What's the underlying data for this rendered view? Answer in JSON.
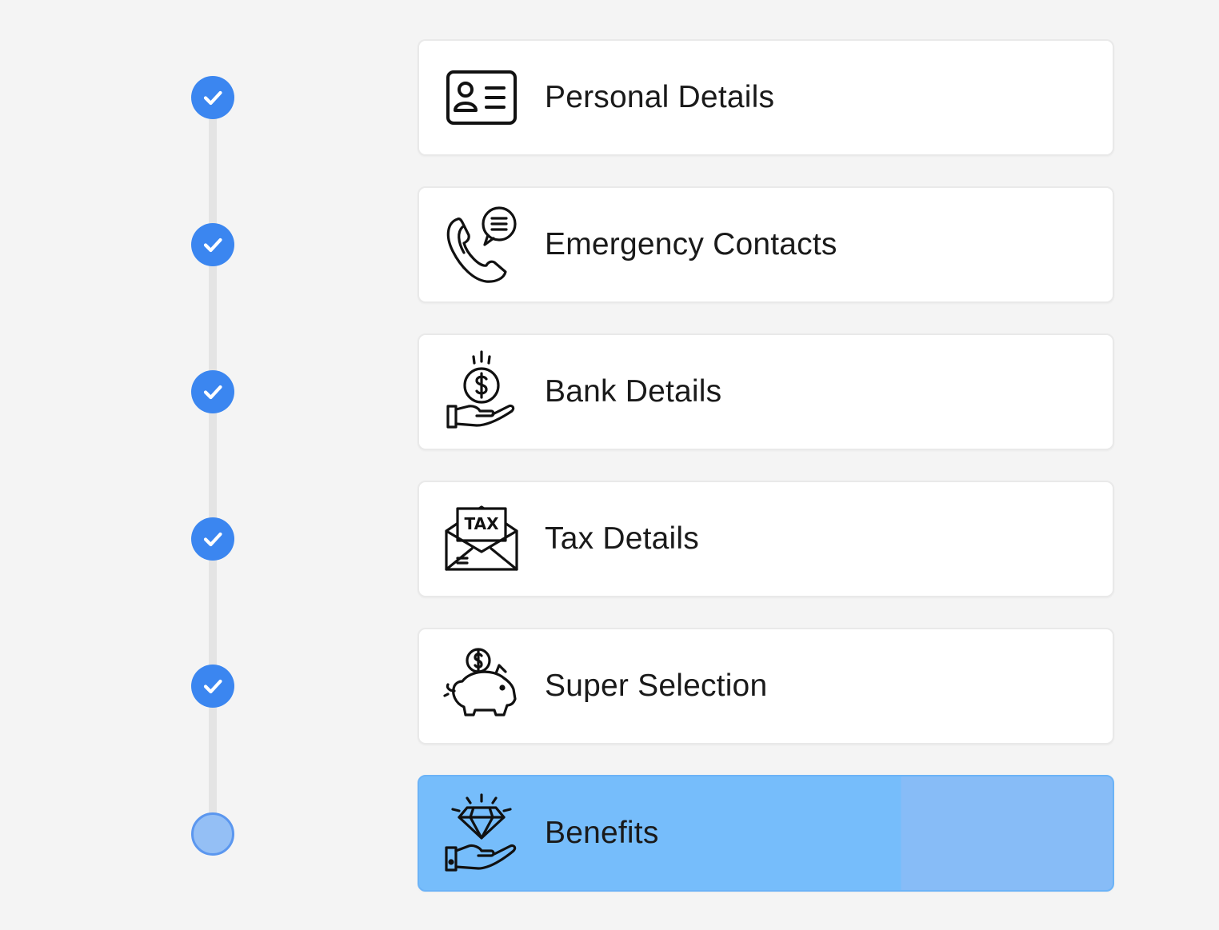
{
  "theme": {
    "background": "#f4f4f4",
    "accent": "#3b86f0",
    "pending_dot": "#94bff5",
    "active_card": "#76bdfb"
  },
  "steps": [
    {
      "label": "Personal Details",
      "icon": "id-card-icon",
      "status": "completed"
    },
    {
      "label": "Emergency Contacts",
      "icon": "phone-chat-icon",
      "status": "completed"
    },
    {
      "label": "Bank Details",
      "icon": "hand-dollar-coin-icon",
      "status": "completed"
    },
    {
      "label": "Tax Details",
      "icon": "tax-envelope-icon",
      "status": "completed"
    },
    {
      "label": "Super Selection",
      "icon": "piggy-bank-icon",
      "status": "completed"
    },
    {
      "label": "Benefits",
      "icon": "hand-diamond-icon",
      "status": "current"
    }
  ]
}
